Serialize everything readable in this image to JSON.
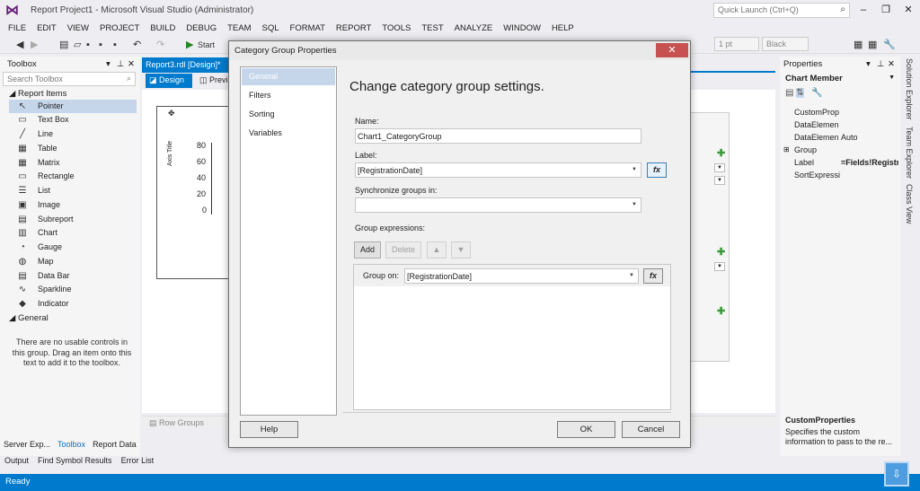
{
  "window": {
    "title": "Report Project1 - Microsoft Visual Studio (Administrator)",
    "quick_launch_placeholder": "Quick Launch (Ctrl+Q)"
  },
  "menu": [
    "FILE",
    "EDIT",
    "VIEW",
    "PROJECT",
    "BUILD",
    "DEBUG",
    "TEAM",
    "SQL",
    "FORMAT",
    "REPORT",
    "TOOLS",
    "TEST",
    "ANALYZE",
    "WINDOW",
    "HELP"
  ],
  "toolbar": {
    "start_label": "Start",
    "line_width": "1 pt",
    "line_color": "Black"
  },
  "toolbox": {
    "title": "Toolbox",
    "search_placeholder": "Search Toolbox",
    "group_report_items": "Report Items",
    "items": [
      {
        "label": "Pointer",
        "icon": "pointer-icon",
        "glyph": "↖"
      },
      {
        "label": "Text Box",
        "icon": "textbox-icon",
        "glyph": "▭"
      },
      {
        "label": "Line",
        "icon": "line-icon",
        "glyph": "╱"
      },
      {
        "label": "Table",
        "icon": "table-icon",
        "glyph": "▦"
      },
      {
        "label": "Matrix",
        "icon": "matrix-icon",
        "glyph": "▦"
      },
      {
        "label": "Rectangle",
        "icon": "rectangle-icon",
        "glyph": "▭"
      },
      {
        "label": "List",
        "icon": "list-icon",
        "glyph": "☰"
      },
      {
        "label": "Image",
        "icon": "image-icon",
        "glyph": "▣"
      },
      {
        "label": "Subreport",
        "icon": "subreport-icon",
        "glyph": "▤"
      },
      {
        "label": "Chart",
        "icon": "chart-icon",
        "glyph": "▥"
      },
      {
        "label": "Gauge",
        "icon": "gauge-icon",
        "glyph": "◔"
      },
      {
        "label": "Map",
        "icon": "map-icon",
        "glyph": "◍"
      },
      {
        "label": "Data Bar",
        "icon": "databar-icon",
        "glyph": "▤"
      },
      {
        "label": "Sparkline",
        "icon": "sparkline-icon",
        "glyph": "∿"
      },
      {
        "label": "Indicator",
        "icon": "indicator-icon",
        "glyph": "◆"
      }
    ],
    "group_general": "General",
    "empty_note": "There are no usable controls in this group. Drag an item onto this text to add it to the toolbox.",
    "bottom_tabs": [
      "Server Exp...",
      "Toolbox",
      "Report Data"
    ]
  },
  "output_tabs": [
    "Output",
    "Find Symbol Results",
    "Error List"
  ],
  "editor": {
    "doc_tab": "Report3.rdl [Design]*",
    "design_tab": "Design",
    "preview_tab": "Previ",
    "y_ticks": [
      "80",
      "60",
      "40",
      "20",
      "0"
    ],
    "axis_title": "Axis Title",
    "row_groups": "Row Groups"
  },
  "properties": {
    "title": "Properties",
    "object": "Chart Member",
    "rows": [
      {
        "name": "CustomProp",
        "value": ""
      },
      {
        "name": "DataElemen",
        "value": ""
      },
      {
        "name": "DataElemen",
        "value": "Auto"
      },
      {
        "name": "Group",
        "value": ""
      },
      {
        "name": "Label",
        "value": "=Fields!Registra"
      },
      {
        "name": "SortExpressi",
        "value": ""
      }
    ],
    "desc_title": "CustomProperties",
    "desc_text": "Specifies the custom information to pass to the re..."
  },
  "side_tabs": [
    "Solution Explorer",
    "Team Explorer",
    "Class View"
  ],
  "status": {
    "text": "Ready"
  },
  "dialog": {
    "title": "Category Group Properties",
    "nav": [
      "General",
      "Filters",
      "Sorting",
      "Variables"
    ],
    "heading": "Change category group settings.",
    "name_label": "Name:",
    "name_value": "Chart1_CategoryGroup",
    "label_label": "Label:",
    "label_value": "[RegistrationDate]",
    "sync_label": "Synchronize groups in:",
    "sync_value": "",
    "group_expr_label": "Group expressions:",
    "add_label": "Add",
    "delete_label": "Delete",
    "group_on_label": "Group on:",
    "group_on_value": "[RegistrationDate]",
    "fx_label": "fx",
    "help_label": "Help",
    "ok_label": "OK",
    "cancel_label": "Cancel"
  }
}
